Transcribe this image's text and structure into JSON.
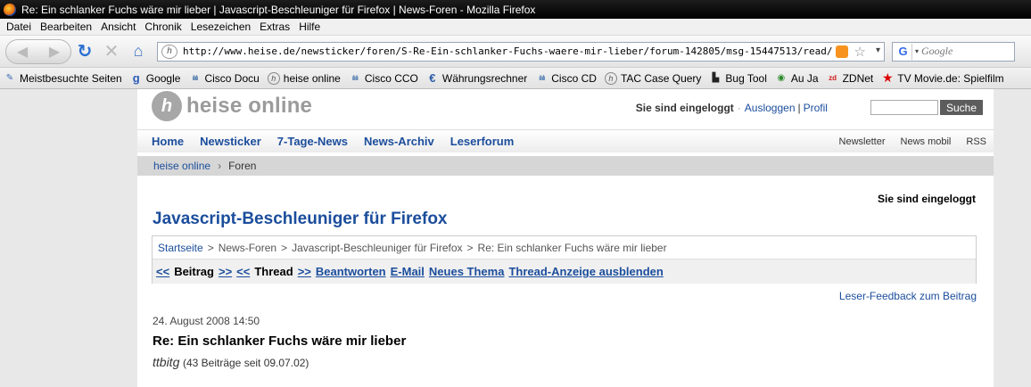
{
  "window": {
    "title": "Re: Ein schlanker Fuchs wäre mir lieber | Javascript-Beschleuniger für Firefox | News-Foren - Mozilla Firefox"
  },
  "menu": [
    "Datei",
    "Bearbeiten",
    "Ansicht",
    "Chronik",
    "Lesezeichen",
    "Extras",
    "Hilfe"
  ],
  "toolbar": {
    "url": "http://www.heise.de/newsticker/foren/S-Re-Ein-schlanker-Fuchs-waere-mir-lieber/forum-142805/msg-15447513/read/",
    "search_placeholder": "Google"
  },
  "bookmarks": [
    {
      "label": "Meistbesuchte Seiten",
      "icon": "folder-icon",
      "glyph": "✎"
    },
    {
      "label": "Google",
      "icon": "google-icon",
      "glyph": "g"
    },
    {
      "label": "Cisco Docu",
      "icon": "cisco-icon",
      "glyph": "ılıılı"
    },
    {
      "label": "heise online",
      "icon": "heise-icon",
      "glyph": "h"
    },
    {
      "label": "Cisco CCO",
      "icon": "cisco-icon",
      "glyph": "ılıılı"
    },
    {
      "label": "Währungsrechner",
      "icon": "euro-icon",
      "glyph": "€"
    },
    {
      "label": "Cisco CD",
      "icon": "cisco-icon",
      "glyph": "ılıılı"
    },
    {
      "label": "TAC Case Query",
      "icon": "heise-icon",
      "glyph": "h"
    },
    {
      "label": "Bug Tool",
      "icon": "bar-chart-icon",
      "glyph": "▙"
    },
    {
      "label": "Au Ja",
      "icon": "globe-icon",
      "glyph": "◉"
    },
    {
      "label": "ZDNet",
      "icon": "zdnet-icon",
      "glyph": "zd"
    },
    {
      "label": "TV Movie.de: Spielfilm",
      "icon": "star-icon",
      "glyph": "★"
    }
  ],
  "site": {
    "brand": "heise online",
    "logged_in": "Sie sind eingeloggt",
    "logout": "Ausloggen",
    "profile": "Profil",
    "search_button": "Suche",
    "nav": [
      "Home",
      "Newsticker",
      "7-Tage-News",
      "News-Archiv",
      "Leserforum"
    ],
    "nav_right": [
      "Newsletter",
      "News mobil",
      "RSS"
    ],
    "breadcrumb": {
      "home": "heise online",
      "current": "Foren"
    }
  },
  "forum": {
    "logged_in": "Sie sind eingeloggt",
    "title": "Javascript-Beschleuniger für Firefox",
    "path": {
      "start": "Startseite",
      "news_forums": "News-Foren",
      "forum": "Javascript-Beschleuniger für Firefox",
      "post": "Re: Ein schlanker Fuchs wäre mir lieber"
    },
    "actions": {
      "prev_post": "<<",
      "post_label": "Beitrag",
      "next_post": ">>",
      "prev_thread": "<<",
      "thread_label": "Thread",
      "next_thread": ">>",
      "reply": "Beantworten",
      "email": "E-Mail",
      "new_topic": "Neues Thema",
      "hide_thread": "Thread-Anzeige ausblenden"
    },
    "feedback": "Leser-Feedback zum Beitrag",
    "post": {
      "date": "24. August 2008 14:50",
      "title": "Re: Ein schlanker Fuchs wäre mir lieber",
      "author": "ttbitg",
      "author_info": "(43 Beiträge seit 09.07.02)"
    }
  }
}
